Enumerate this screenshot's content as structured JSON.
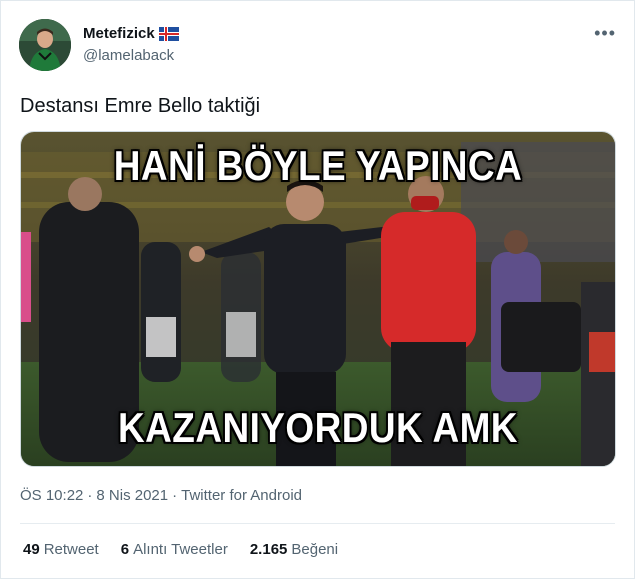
{
  "user": {
    "display_name": "Metefizick",
    "handle": "@lamelaback",
    "flag_icon": "iceland-flag-icon",
    "avatar_icon": "profile-photo"
  },
  "menu_icon": "more-options-icon",
  "tweet": {
    "text": "Destansı Emre Bello taktiği",
    "media": {
      "top_caption": "HANİ BÖYLE YAPINCA",
      "bottom_caption": "KAZANIYORDUK AMK"
    }
  },
  "meta": {
    "time": "ÖS 10:22",
    "separator1": "·",
    "date": "8 Nis 2021",
    "separator2": "·",
    "source": "Twitter for Android"
  },
  "stats": [
    {
      "count": "49",
      "label": "Retweet"
    },
    {
      "count": "6",
      "label": "Alıntı Tweetler"
    },
    {
      "count": "2.165",
      "label": "Beğeni"
    }
  ],
  "colors": {
    "text_primary": "#0f1419",
    "text_secondary": "#536471",
    "border": "#e1e8ed"
  }
}
